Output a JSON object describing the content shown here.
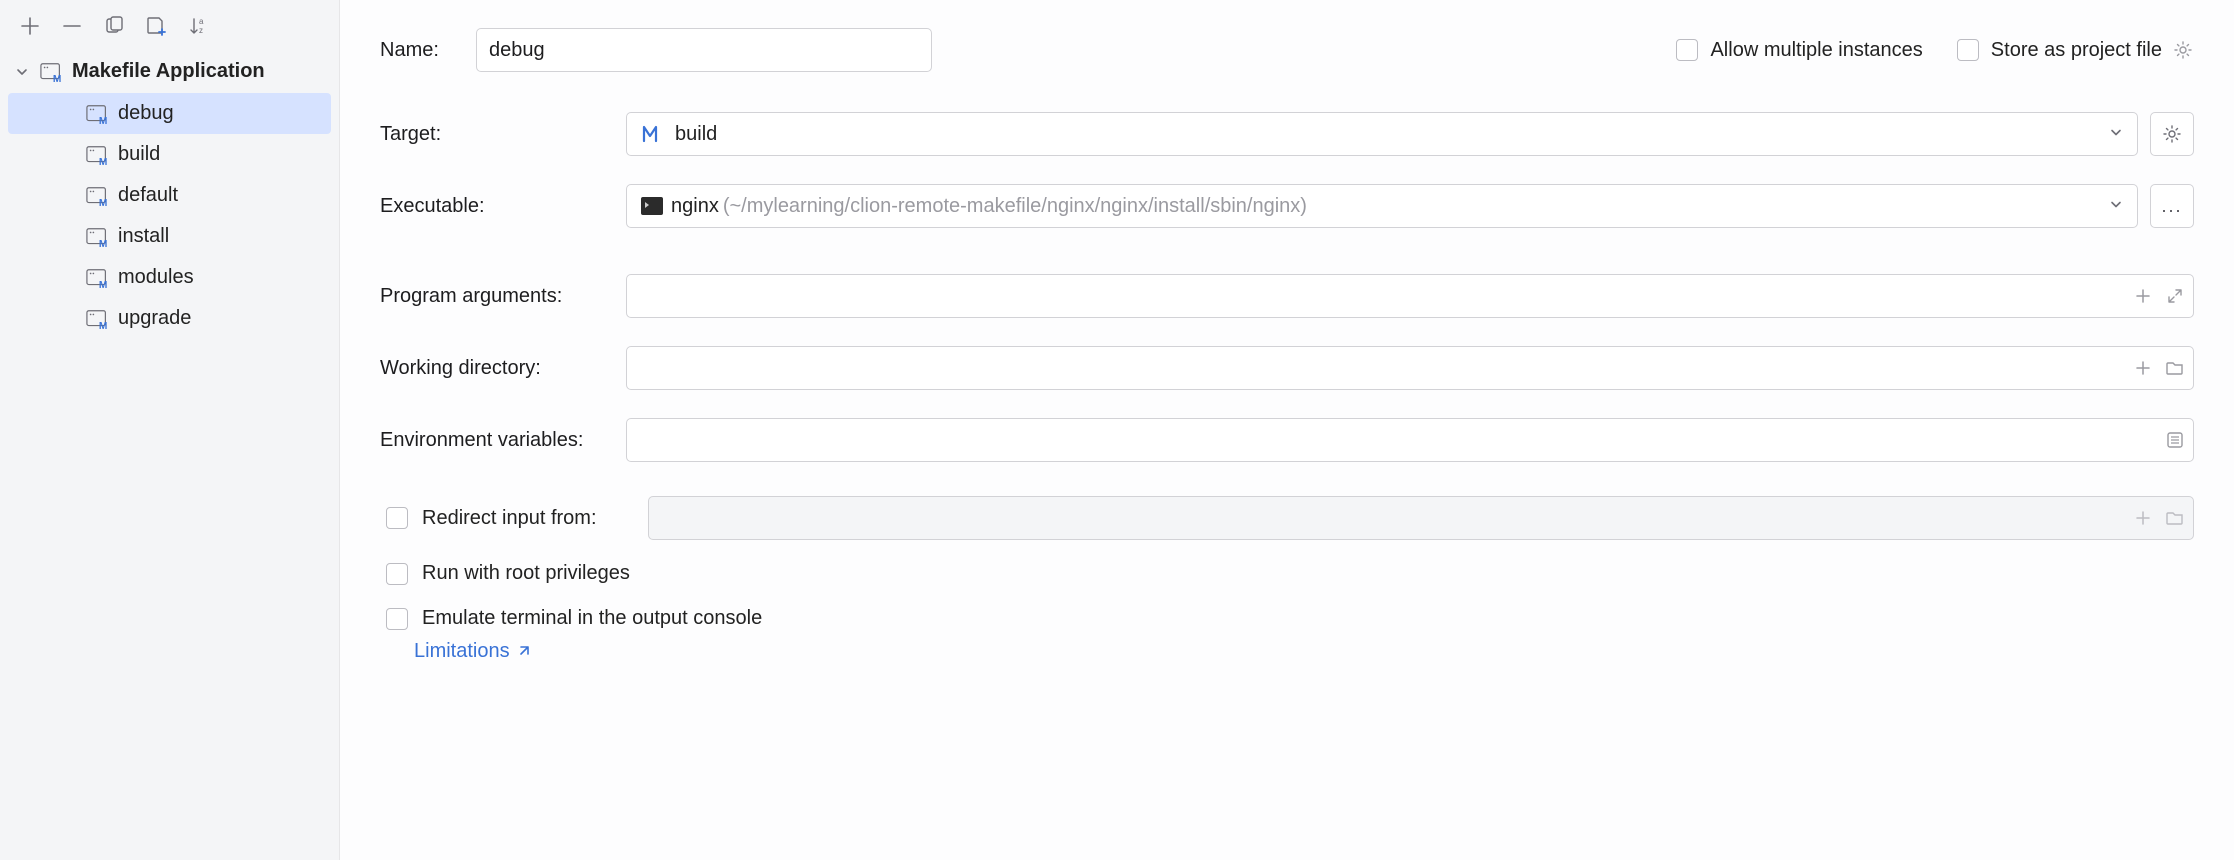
{
  "toolbar": {
    "add": "add",
    "remove": "remove",
    "copy": "copy",
    "folder_add": "folder-add",
    "sort": "sort"
  },
  "tree": {
    "parent_label": "Makefile Application",
    "selected": "debug",
    "items": [
      {
        "label": "debug"
      },
      {
        "label": "build"
      },
      {
        "label": "default"
      },
      {
        "label": "install"
      },
      {
        "label": "modules"
      },
      {
        "label": "upgrade"
      }
    ]
  },
  "form": {
    "name_label": "Name:",
    "name_value": "debug",
    "allow_multiple_label": "Allow multiple instances",
    "store_project_label": "Store as project file",
    "target_label": "Target:",
    "target_value": "build",
    "executable_label": "Executable:",
    "executable_name": "nginx",
    "executable_path": "(~/mylearning/clion-remote-makefile/nginx/nginx/install/sbin/nginx)",
    "program_args_label": "Program arguments:",
    "program_args_value": "",
    "working_dir_label": "Working directory:",
    "working_dir_value": "",
    "env_vars_label": "Environment variables:",
    "env_vars_value": "",
    "redirect_input_label": "Redirect input from:",
    "redirect_input_value": "",
    "root_priv_label": "Run with root privileges",
    "emulate_terminal_label": "Emulate terminal in the output console",
    "limitations_link": "Limitations"
  }
}
